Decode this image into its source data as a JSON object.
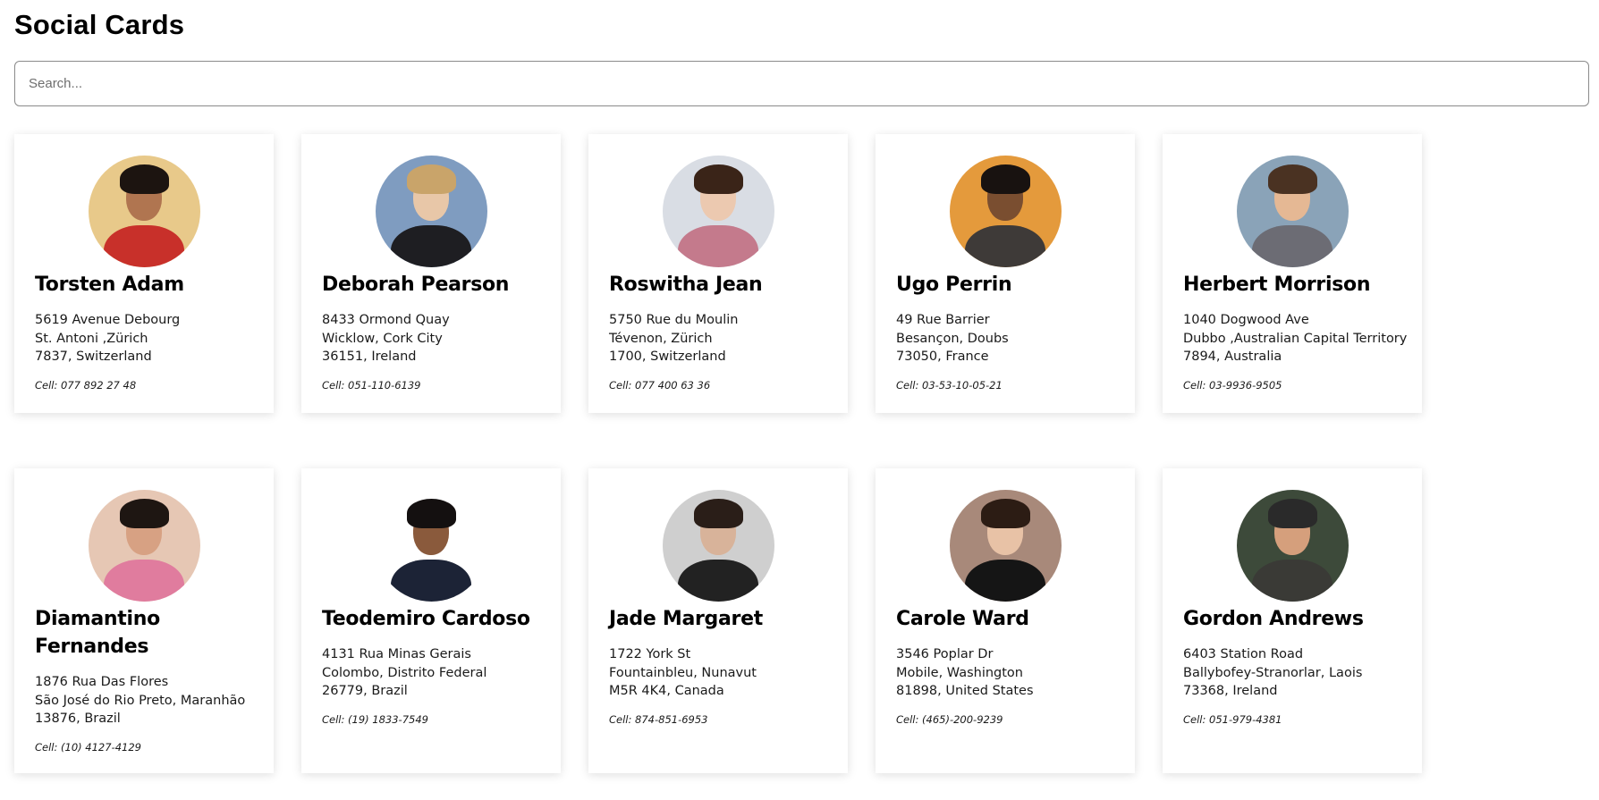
{
  "page": {
    "title": "Social Cards"
  },
  "search": {
    "placeholder": "Search...",
    "value": ""
  },
  "cards": [
    {
      "name": "Torsten Adam",
      "street": "5619 Avenue Debourg",
      "city_line": "St. Antoni ,Zürich",
      "postal_line": "7837, Switzerland",
      "cell": "Cell: 077 892 27 48",
      "avatar": {
        "bg": "#e8c98a",
        "skin": "#b07550",
        "hair": "#1c1410",
        "shirt": "#c8302a"
      }
    },
    {
      "name": "Deborah Pearson",
      "street": "8433 Ormond Quay",
      "city_line": "Wicklow, Cork City",
      "postal_line": "36151, Ireland",
      "cell": "Cell: 051-110-6139",
      "avatar": {
        "bg": "#7f9cc0",
        "skin": "#e8c7a8",
        "hair": "#c9a46a",
        "shirt": "#1e1e22"
      }
    },
    {
      "name": "Roswitha Jean",
      "street": "5750 Rue du Moulin",
      "city_line": "Tévenon, Zürich",
      "postal_line": "1700, Switzerland",
      "cell": "Cell: 077 400 63 36",
      "avatar": {
        "bg": "#d9dde4",
        "skin": "#ecc9b0",
        "hair": "#3a2418",
        "shirt": "#c47a8c"
      }
    },
    {
      "name": "Ugo Perrin",
      "street": "49 Rue Barrier",
      "city_line": "Besançon, Doubs",
      "postal_line": "73050, France",
      "cell": "Cell: 03-53-10-05-21",
      "avatar": {
        "bg": "#e49a3c",
        "skin": "#7a4e30",
        "hair": "#181210",
        "shirt": "#3e3a38"
      }
    },
    {
      "name": "Herbert Morrison",
      "street": "1040 Dogwood Ave",
      "city_line": "Dubbo ,Australian Capital Territory",
      "postal_line": "7894, Australia",
      "cell": "Cell: 03-9936-9505",
      "avatar": {
        "bg": "#8aa3b8",
        "skin": "#e5b894",
        "hair": "#4a3222",
        "shirt": "#6c6c74"
      }
    },
    {
      "name": "Diamantino Fernandes",
      "street": "1876 Rua Das Flores",
      "city_line": "São José do Rio Preto, Maranhão",
      "postal_line": "13876, Brazil",
      "cell": "Cell: (10) 4127-4129",
      "avatar": {
        "bg": "#e6c7b4",
        "skin": "#d7a183",
        "hair": "#1e1612",
        "shirt": "#e07c9e"
      }
    },
    {
      "name": "Teodemiro Cardoso",
      "street": "4131 Rua Minas Gerais",
      "city_line": "Colombo, Distrito Federal",
      "postal_line": "26779, Brazil",
      "cell": "Cell: (19) 1833-7549",
      "avatar": {
        "bg": "#ffffff",
        "skin": "#8a5a3c",
        "hair": "#141010",
        "shirt": "#1c2336"
      }
    },
    {
      "name": "Jade Margaret",
      "street": "1722 York St",
      "city_line": "Fountainbleu, Nunavut",
      "postal_line": "M5R 4K4, Canada",
      "cell": "Cell: 874-851-6953",
      "avatar": {
        "bg": "#cfcfcf",
        "skin": "#d8b39a",
        "hair": "#2a1e18",
        "shirt": "#222222"
      }
    },
    {
      "name": "Carole Ward",
      "street": "3546 Poplar Dr",
      "city_line": "Mobile, Washington",
      "postal_line": "81898, United States",
      "cell": "Cell: (465)-200-9239",
      "avatar": {
        "bg": "#a8897a",
        "skin": "#e8c2a6",
        "hair": "#2c1c14",
        "shirt": "#151515"
      }
    },
    {
      "name": "Gordon Andrews",
      "street": "6403 Station Road",
      "city_line": "Ballybofey-Stranorlar, Laois",
      "postal_line": "73368, Ireland",
      "cell": "Cell: 051-979-4381",
      "avatar": {
        "bg": "#3d4a3a",
        "skin": "#d59f7c",
        "hair": "#2a2a2a",
        "shirt": "#3a3a36"
      }
    }
  ]
}
